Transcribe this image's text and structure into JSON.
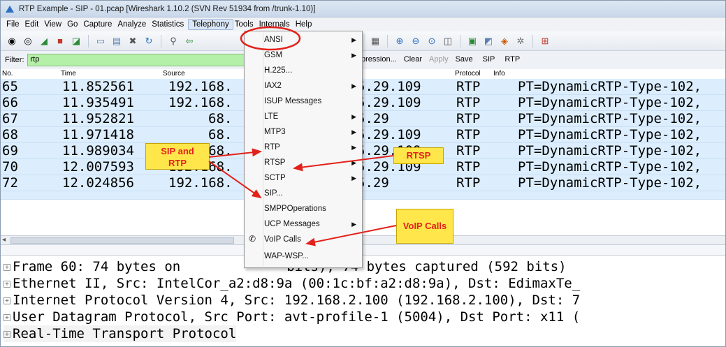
{
  "window": {
    "title": "RTP Example - SIP - 01.pcap  [Wireshark 1.10.2  (SVN Rev 51934 from /trunk-1.10)]"
  },
  "menu": [
    "File",
    "Edit",
    "View",
    "Go",
    "Capture",
    "Analyze",
    "Statistics",
    "Telephony",
    "Tools",
    "Internals",
    "Help"
  ],
  "toolbar": {
    "icons": [
      "start-capture-icon",
      "capture-options-icon",
      "shark-fin-icon",
      "stop-capture-icon",
      "restart-icon",
      "open-file-icon",
      "save-file-icon",
      "close-file-icon",
      "reload-icon",
      "find-icon",
      "back-icon",
      "zoom-in-icon",
      "zoom-out-icon",
      "zoom-normal-icon",
      "resize-columns-icon",
      "capture-filters-icon",
      "display-filters-icon",
      "coloring-rules-icon",
      "preferences-icon",
      "help-icon"
    ]
  },
  "filter": {
    "label": "Filter:",
    "value": "rtp",
    "expression_label": "pression...",
    "clear_label": "Clear",
    "apply_label": "Apply",
    "save_label": "Save",
    "sip_label": "SIP",
    "rtp_label": "RTP"
  },
  "packet_list": {
    "headers": {
      "no": "No.",
      "time": "Time",
      "source": "Source",
      "protocol": "Protocol",
      "info": "Info"
    },
    "rows": [
      {
        "no": "65",
        "time": "11.852561",
        "source": "192.168.",
        "dest": "5.29.109",
        "protocol": "RTP",
        "info": "PT=DynamicRTP-Type-102,"
      },
      {
        "no": "66",
        "time": "11.935491",
        "source": "192.168.",
        "dest": "5.29.109",
        "protocol": "RTP",
        "info": "PT=DynamicRTP-Type-102,"
      },
      {
        "no": "67",
        "time": "11.952821",
        "source": "68.",
        "dest": "5.29",
        "protocol": "RTP",
        "info": "PT=DynamicRTP-Type-102,"
      },
      {
        "no": "68",
        "time": "11.971418",
        "source": "68.",
        "dest": "5.29.109",
        "protocol": "RTP",
        "info": "PT=DynamicRTP-Type-102,"
      },
      {
        "no": "69",
        "time": "11.989034",
        "source": "192.168.",
        "dest": "5.29.109",
        "protocol": "RTP",
        "info": "PT=DynamicRTP-Type-102,"
      },
      {
        "no": "70",
        "time": "12.007593",
        "source": "192.168.",
        "dest": "5.29.109",
        "protocol": "RTP",
        "info": "PT=DynamicRTP-Type-102,"
      },
      {
        "no": "72",
        "time": "12.024856",
        "source": "192.168.",
        "dest": "5.29",
        "protocol": "RTP",
        "info": "PT=DynamicRTP-Type-102,"
      }
    ]
  },
  "details": [
    "Frame 60: 74 bytes on",
    "bits), 74 bytes captured (592 bits)",
    "Ethernet II, Src: IntelCor_a2:d8:9a (00:1c:bf:a2:d8:9a), Dst: EdimaxTe_",
    "Internet Protocol Version 4, Src: 192.168.2.100 (192.168.2.100), Dst: 7",
    "User Datagram Protocol, Src Port: avt-profile-1 (5004), Dst Port: x11 (",
    "Real-Time Transport Protocol"
  ],
  "telephony_menu": [
    {
      "label": "ANSI",
      "submenu": true
    },
    {
      "label": "GSM",
      "submenu": true
    },
    {
      "label": "H.225...",
      "submenu": false
    },
    {
      "label": "IAX2",
      "submenu": true
    },
    {
      "label": "ISUP Messages",
      "submenu": false
    },
    {
      "label": "LTE",
      "submenu": true
    },
    {
      "label": "MTP3",
      "submenu": true
    },
    {
      "label": "RTP",
      "submenu": true
    },
    {
      "label": "RTSP",
      "submenu": true
    },
    {
      "label": "SCTP",
      "submenu": true
    },
    {
      "label": "SIP...",
      "submenu": false
    },
    {
      "label": "SMPPOperations",
      "submenu": false
    },
    {
      "label": "UCP Messages",
      "submenu": true
    },
    {
      "label": "VoIP Calls",
      "submenu": false,
      "icon": "phone-icon"
    },
    {
      "label": "WAP-WSP...",
      "submenu": false
    }
  ],
  "annotations": {
    "sip_rtp_line1": "SIP and",
    "sip_rtp_line2": "RTP",
    "rtsp": "RTSP",
    "voip": "VoIP Calls"
  },
  "colors": {
    "row_bg": "#dceefe",
    "filter_bg": "#b5f0a8",
    "callout_bg": "#ffe64a",
    "callout_text": "#e3211b",
    "arrow": "#e3211b"
  }
}
